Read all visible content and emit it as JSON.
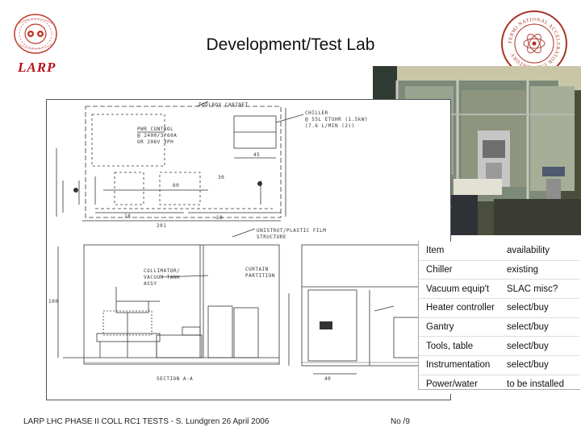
{
  "slide": {
    "title": "Development/Test Lab",
    "larp_logo_text": "LARP",
    "seal_text": "FERMI NATIONAL ACCELERATOR LABORATORY",
    "footer_left": "LARP LHC PHASE II COLL RC1 TESTS  -  S. Lundgren 26 April 2006",
    "footer_page": "No /9"
  },
  "drawing": {
    "labels": {
      "toolbox": "TOOLBOX CABINET",
      "chiller_1": "CHILLER",
      "chiller_2": "@ 55L ETUHR (1.5kW)",
      "chiller_3": "(7.6 L/MIN (2))",
      "pwr_1": "PWR CONTROL",
      "pwr_2": "@ 2400/3/60A",
      "pwr_3": "OR 208V 3PH",
      "unistrut_1": "UNISTRUT/PLASTIC FILM",
      "unistrut_2": "STRUCTURE",
      "curtain_1": "CURTAIN",
      "curtain_2": "PARTITION",
      "collimator_1": "COLLIMATOR/",
      "collimator_2": "VACUUM TANK",
      "collimator_3": "ASSY",
      "section": "SECTION A-A"
    },
    "dims": {
      "d30": "30",
      "d45": "45",
      "d60": "60",
      "d18a": "18",
      "d18b": "18",
      "d201": "201",
      "d100": "100",
      "d40": "40"
    }
  },
  "table": {
    "header": {
      "item": "Item",
      "availability": "availability"
    },
    "rows": [
      {
        "item": "Chiller",
        "availability": "existing"
      },
      {
        "item": "Vacuum equip't",
        "availability": "SLAC misc?"
      },
      {
        "item": "Heater controller",
        "availability": "select/buy"
      },
      {
        "item": "Gantry",
        "availability": "select/buy"
      },
      {
        "item": "Tools, table",
        "availability": "select/buy"
      },
      {
        "item": "Instrumentation",
        "availability": "select/buy"
      },
      {
        "item": "Power/water",
        "availability": "to be installed"
      }
    ]
  }
}
